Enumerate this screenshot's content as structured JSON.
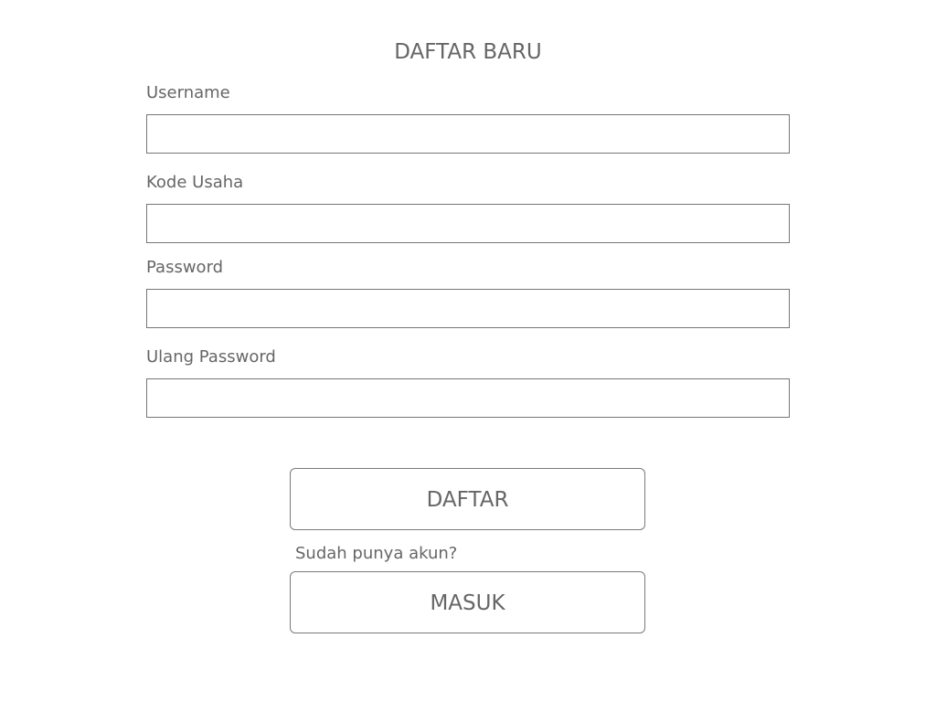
{
  "title": "DAFTAR BARU",
  "fields": [
    {
      "label": "Username",
      "value": "",
      "placeholder": ""
    },
    {
      "label": "Kode Usaha",
      "value": "",
      "placeholder": ""
    },
    {
      "label": "Password",
      "value": "",
      "placeholder": ""
    },
    {
      "label": "Ulang Password",
      "value": "",
      "placeholder": ""
    }
  ],
  "register_button": "DAFTAR",
  "login_prompt": "Sudah punya akun?",
  "login_button": "MASUK"
}
